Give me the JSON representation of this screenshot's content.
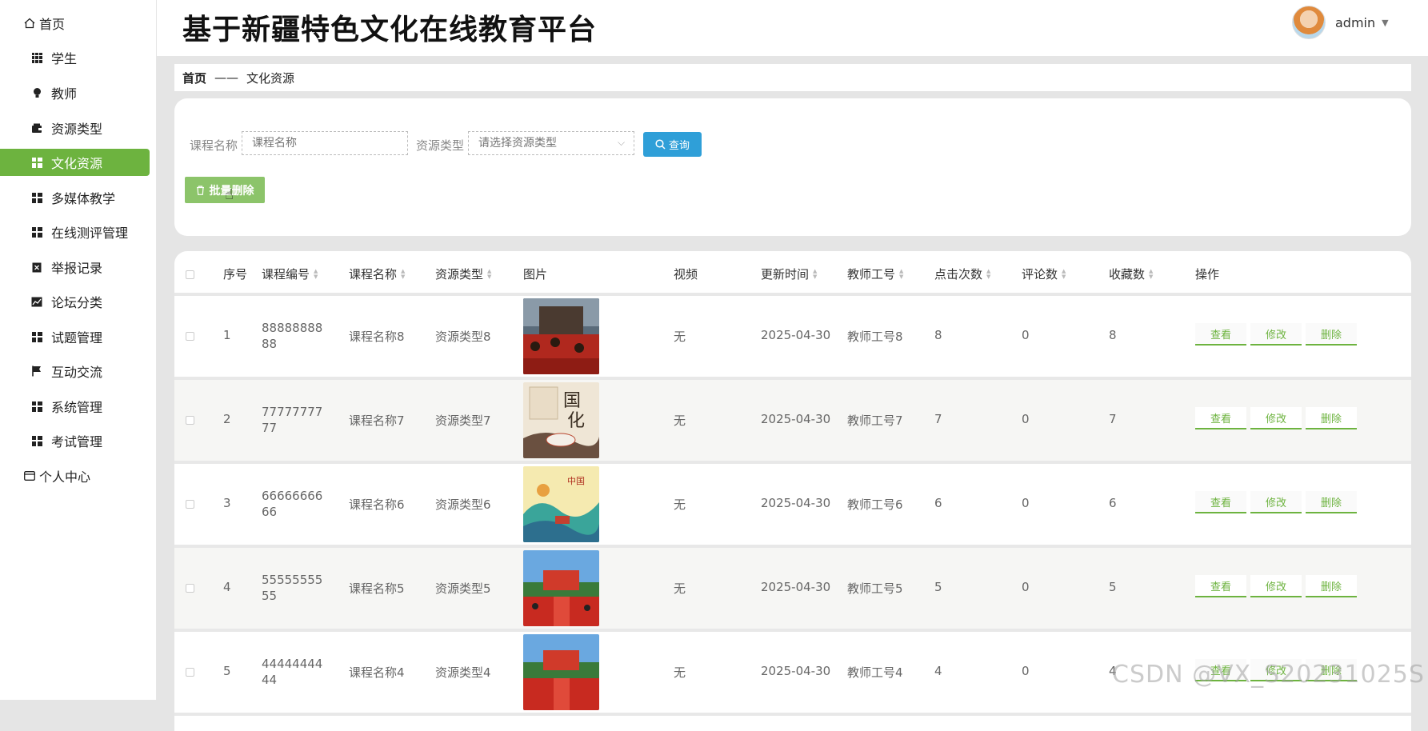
{
  "app": {
    "title": "基于新疆特色文化在线教育平台"
  },
  "user": {
    "name": "admin"
  },
  "sidebar": {
    "items": [
      {
        "label": "首页",
        "icon": "home-icon"
      },
      {
        "label": "学生",
        "icon": "grid-icon"
      },
      {
        "label": "教师",
        "icon": "bulb-icon"
      },
      {
        "label": "资源类型",
        "icon": "wallet-icon"
      },
      {
        "label": "文化资源",
        "icon": "grid-icon",
        "active": true
      },
      {
        "label": "多媒体教学",
        "icon": "grid-icon"
      },
      {
        "label": "在线测评管理",
        "icon": "grid-icon"
      },
      {
        "label": "举报记录",
        "icon": "clipboard-icon"
      },
      {
        "label": "论坛分类",
        "icon": "chart-icon"
      },
      {
        "label": "试题管理",
        "icon": "grid-icon"
      },
      {
        "label": "互动交流",
        "icon": "flag-icon"
      },
      {
        "label": "系统管理",
        "icon": "grid-icon"
      },
      {
        "label": "考试管理",
        "icon": "grid-icon"
      },
      {
        "label": "个人中心",
        "icon": "card-icon"
      }
    ]
  },
  "breadcrumb": {
    "home": "首页",
    "sep": "——",
    "current": "文化资源"
  },
  "search": {
    "course_label": "课程名称",
    "course_placeholder": "课程名称",
    "type_label": "资源类型",
    "type_placeholder": "请选择资源类型",
    "query_label": "查询",
    "batch_delete_label": "批量删除"
  },
  "table": {
    "headers": {
      "index": "序号",
      "code": "课程编号",
      "name": "课程名称",
      "type": "资源类型",
      "image": "图片",
      "video": "视频",
      "updated": "更新时间",
      "teacher": "教师工号",
      "clicks": "点击次数",
      "comments": "评论数",
      "favorites": "收藏数",
      "actions": "操作"
    },
    "action_labels": {
      "view": "查看",
      "edit": "修改",
      "delete": "删除"
    },
    "rows": [
      {
        "index": "1",
        "code": "8888888888",
        "name": "课程名称8",
        "type": "资源类型8",
        "video": "无",
        "updated": "2025-04-30",
        "teacher": "教师工号8",
        "clicks": "8",
        "comments": "0",
        "favorites": "8"
      },
      {
        "index": "2",
        "code": "7777777777",
        "name": "课程名称7",
        "type": "资源类型7",
        "video": "无",
        "updated": "2025-04-30",
        "teacher": "教师工号7",
        "clicks": "7",
        "comments": "0",
        "favorites": "7"
      },
      {
        "index": "3",
        "code": "6666666666",
        "name": "课程名称6",
        "type": "资源类型6",
        "video": "无",
        "updated": "2025-04-30",
        "teacher": "教师工号6",
        "clicks": "6",
        "comments": "0",
        "favorites": "6"
      },
      {
        "index": "4",
        "code": "5555555555",
        "name": "课程名称5",
        "type": "资源类型5",
        "video": "无",
        "updated": "2025-04-30",
        "teacher": "教师工号5",
        "clicks": "5",
        "comments": "0",
        "favorites": "5"
      },
      {
        "index": "5",
        "code": "4444444444",
        "name": "课程名称4",
        "type": "资源类型4",
        "video": "无",
        "updated": "2025-04-30",
        "teacher": "教师工号4",
        "clicks": "4",
        "comments": "0",
        "favorites": "4"
      }
    ]
  },
  "watermark": "CSDN @VX_S2023102​5S",
  "colors": {
    "accent": "#6db33f",
    "query": "#2f9fd8",
    "batch_delete": "#8cc46a"
  }
}
